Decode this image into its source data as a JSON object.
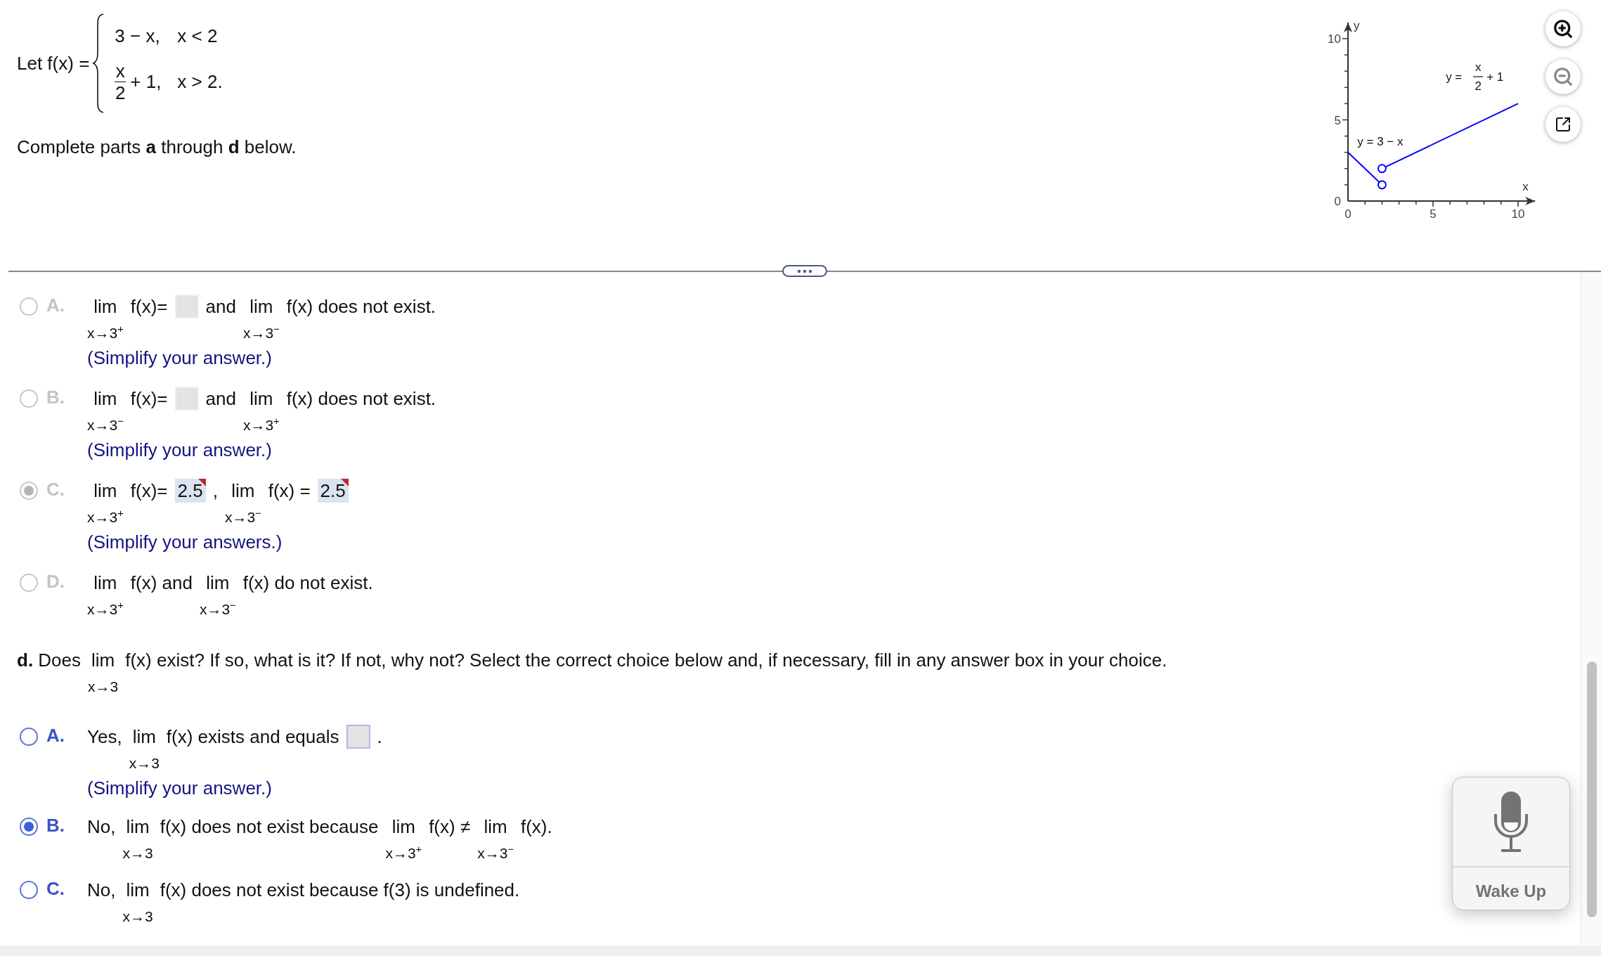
{
  "problem": {
    "lead": "Let f(x) =",
    "cases": [
      {
        "expr": {
          "text": "3 − x,"
        },
        "condition": "x < 2"
      },
      {
        "expr": {
          "numerator": "x",
          "denominator": "2",
          "tail": "+ 1,"
        },
        "condition": "x > 2."
      }
    ],
    "instruction": "Complete parts **a** through **d** below."
  },
  "graph": {
    "chart_data": {
      "type": "line",
      "xlabel": "x",
      "ylabel": "y",
      "x": [
        0,
        2,
        10
      ],
      "series": [
        {
          "color": "#0000ff",
          "values": [
            3,
            1,
            null
          ]
        },
        {
          "color": "#0000ff",
          "values": [
            null,
            2,
            6
          ]
        }
      ],
      "xlim": [
        0,
        11
      ],
      "ylim": [
        0,
        11
      ],
      "xticks": [
        0,
        5,
        10
      ],
      "yticks": [
        0,
        5,
        10
      ]
    },
    "open_endpoints": true,
    "curve_labels": [
      {
        "kind": "plain",
        "text": "y = 3 − x"
      },
      {
        "kind": "fraction",
        "lead": "y =",
        "numerator": "x",
        "denominator": "2",
        "tail": "+ 1"
      }
    ]
  },
  "graph_tools": [
    {
      "kind": "zoom_in",
      "disabled": false
    },
    {
      "kind": "zoom_out",
      "disabled": true
    },
    {
      "kind": "pop_out",
      "disabled": false
    }
  ],
  "upper_choices": {
    "disabled": true,
    "choices": [
      {
        "letter": "A.",
        "selected": false,
        "line": [
          {
            "kind": "lim",
            "word": "lim",
            "sub": "x→3$^{+}$"
          },
          {
            "kind": "text",
            "text": "f(x)="
          },
          {
            "kind": "box",
            "marked": false
          },
          {
            "kind": "text",
            "text": "and"
          },
          {
            "kind": "lim",
            "word": "lim",
            "sub": "x→3$^{−}$"
          },
          {
            "kind": "text",
            "text": "f(x) does not exist."
          }
        ],
        "hint": "(Simplify your answer.)"
      },
      {
        "letter": "B.",
        "selected": false,
        "line": [
          {
            "kind": "lim",
            "word": "lim",
            "sub": "x→3$^{−}$"
          },
          {
            "kind": "text",
            "text": "f(x)="
          },
          {
            "kind": "box",
            "marked": false
          },
          {
            "kind": "text",
            "text": "and"
          },
          {
            "kind": "lim",
            "word": "lim",
            "sub": "x→3$^{+}$"
          },
          {
            "kind": "text",
            "text": "f(x) does not exist."
          }
        ],
        "hint": "(Simplify your answer.)"
      },
      {
        "letter": "C.",
        "selected": true,
        "line": [
          {
            "kind": "lim",
            "word": "lim",
            "sub": "x→3$^{+}$"
          },
          {
            "kind": "text",
            "text": "f(x)="
          },
          {
            "kind": "box",
            "value": "2.5",
            "marked": true
          },
          {
            "kind": "text",
            "text": ","
          },
          {
            "kind": "lim",
            "word": "lim",
            "sub": "x→3$^{−}$"
          },
          {
            "kind": "text",
            "text": "f(x) ="
          },
          {
            "kind": "box",
            "value": "2.5",
            "marked": true
          }
        ],
        "hint": "(Simplify your answers.)"
      },
      {
        "letter": "D.",
        "selected": false,
        "line": [
          {
            "kind": "lim",
            "word": "lim",
            "sub": "x→3$^{+}$"
          },
          {
            "kind": "text",
            "text": "f(x) and"
          },
          {
            "kind": "lim",
            "word": "lim",
            "sub": "x→3$^{−}$"
          },
          {
            "kind": "text",
            "text": "f(x) do not exist."
          }
        ]
      }
    ]
  },
  "part_d": {
    "question": [
      {
        "kind": "text",
        "text": "**d.** Does"
      },
      {
        "kind": "lim",
        "word": "lim",
        "sub": "x→3"
      },
      {
        "kind": "text",
        "text": "f(x) exist? If so, what is it? If not, why not? Select the correct choice below and, if necessary, fill in any answer box in your choice."
      }
    ],
    "disabled": false,
    "choices": [
      {
        "letter": "A.",
        "selected": false,
        "line": [
          {
            "kind": "text",
            "text": "Yes,"
          },
          {
            "kind": "lim",
            "word": "lim",
            "sub": "x→3"
          },
          {
            "kind": "text",
            "text": "f(x) exists and equals"
          },
          {
            "kind": "box",
            "marked": false
          },
          {
            "kind": "text",
            "text": "."
          }
        ],
        "hint": "(Simplify your answer.)"
      },
      {
        "letter": "B.",
        "selected": true,
        "line": [
          {
            "kind": "text",
            "text": "No,"
          },
          {
            "kind": "lim",
            "word": "lim",
            "sub": "x→3"
          },
          {
            "kind": "text",
            "text": "f(x) does not exist because"
          },
          {
            "kind": "lim",
            "word": "lim",
            "sub": "x→3$^{+}$"
          },
          {
            "kind": "text",
            "text": "f(x) ≠"
          },
          {
            "kind": "lim",
            "word": "lim",
            "sub": "x→3$^{−}$"
          },
          {
            "kind": "text",
            "text": "f(x)."
          }
        ]
      },
      {
        "letter": "C.",
        "selected": false,
        "line": [
          {
            "kind": "text",
            "text": "No,"
          },
          {
            "kind": "lim",
            "word": "lim",
            "sub": "x→3"
          },
          {
            "kind": "text",
            "text": "f(x) does not exist because f(3) is undefined."
          }
        ]
      }
    ]
  },
  "voice_widget": {
    "label": "Wake Up"
  }
}
